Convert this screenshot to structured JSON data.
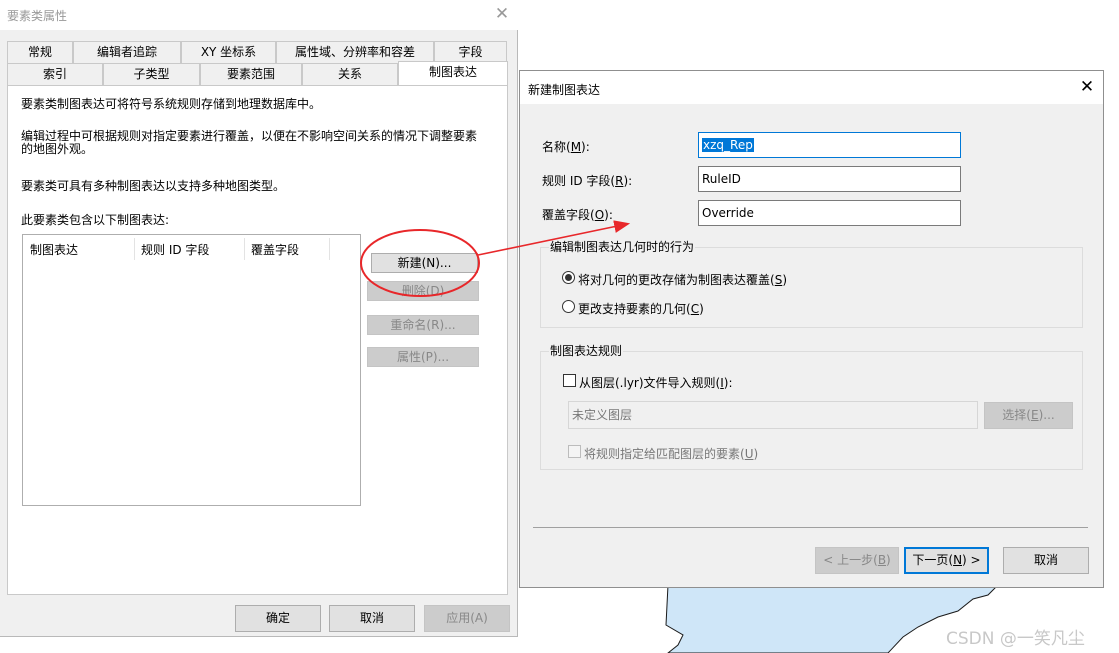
{
  "dialog1": {
    "title": "要素类属性",
    "close_glyph": "✕",
    "tabs_row1": [
      "常规",
      "编辑者追踪",
      "XY 坐标系",
      "属性域、分辨率和容差",
      "字段"
    ],
    "tabs_row2": [
      "索引",
      "子类型",
      "要素范围",
      "关系",
      "制图表达"
    ],
    "active_tab": "制图表达",
    "desc1": "要素类制图表达可将符号系统规则存储到地理数据库中。",
    "desc2_line1": "编辑过程中可根据规则对指定要素进行覆盖，以便在不影响空间关系的情况下调整要素",
    "desc2_line2": "的地图外观。",
    "desc3": "要素类可具有多种制图表达以支持多种地图类型。",
    "list_label": "此要素类包含以下制图表达:",
    "columns": [
      "制图表达",
      "规则 ID 字段",
      "覆盖字段"
    ],
    "buttons": {
      "new": "新建(N)...",
      "delete": "删除(D)",
      "rename": "重命名(R)...",
      "properties": "属性(P)..."
    },
    "footer": {
      "ok": "确定",
      "cancel": "取消",
      "apply": "应用(A)"
    }
  },
  "dialog2": {
    "title": "新建制图表达",
    "close_glyph": "✕",
    "name_label": "名称(",
    "name_key": "M",
    "name_suffix": "):",
    "name_value": "xzq_Rep",
    "ruleid_label": "规则 ID 字段(",
    "ruleid_key": "R",
    "ruleid_suffix": "):",
    "ruleid_value": "RuleID",
    "override_label": "覆盖字段(",
    "override_key": "O",
    "override_suffix": "):",
    "override_value": "Override",
    "behavior_group": "编辑制图表达几何时的行为",
    "radio1_label": "将对几何的更改存储为制图表达覆盖(",
    "radio1_key": "S",
    "radio1_suffix": ")",
    "radio2_label": "更改支持要素的几何(",
    "radio2_key": "C",
    "radio2_suffix": ")",
    "rules_group": "制图表达规则",
    "import_label": "从图层(.lyr)文件导入规则(",
    "import_key": "I",
    "import_suffix": "):",
    "layer_placeholder": "未定义图层",
    "select_label": "选择(",
    "select_key": "E",
    "select_suffix": ")...",
    "assign_label": "将规则指定给匹配图层的要素(",
    "assign_key": "U",
    "assign_suffix": ")",
    "back_prefix": "< 上一步(",
    "back_key": "B",
    "back_suffix": ")",
    "next_prefix": "下一页(",
    "next_key": "N",
    "next_suffix": ") >",
    "cancel": "取消"
  },
  "watermark": "CSDN @一笑凡尘",
  "colors": {
    "map_water": "#cfe6f8",
    "annotation_red": "#e8272a",
    "selection_blue": "#0078d7"
  }
}
